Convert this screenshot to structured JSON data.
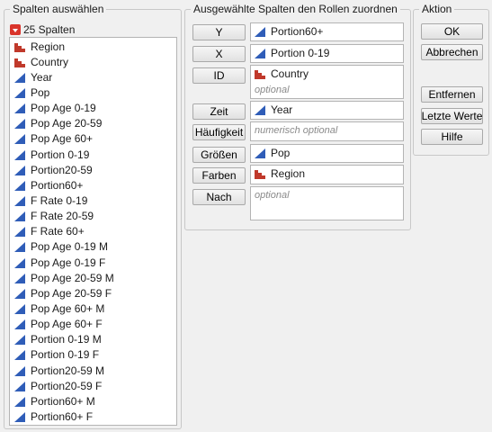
{
  "select_columns": {
    "legend": "Spalten auswählen",
    "count_label": "25 Spalten",
    "columns": [
      {
        "name": "Region",
        "type": "nominal"
      },
      {
        "name": "Country",
        "type": "nominal"
      },
      {
        "name": "Year",
        "type": "continuous"
      },
      {
        "name": "Pop",
        "type": "continuous"
      },
      {
        "name": "Pop Age 0-19",
        "type": "continuous"
      },
      {
        "name": "Pop Age 20-59",
        "type": "continuous"
      },
      {
        "name": "Pop Age 60+",
        "type": "continuous"
      },
      {
        "name": "Portion 0-19",
        "type": "continuous"
      },
      {
        "name": "Portion20-59",
        "type": "continuous"
      },
      {
        "name": "Portion60+",
        "type": "continuous"
      },
      {
        "name": "F Rate 0-19",
        "type": "continuous"
      },
      {
        "name": "F Rate 20-59",
        "type": "continuous"
      },
      {
        "name": "F Rate 60+",
        "type": "continuous"
      },
      {
        "name": "Pop Age 0-19 M",
        "type": "continuous"
      },
      {
        "name": "Pop Age 0-19 F",
        "type": "continuous"
      },
      {
        "name": "Pop Age 20-59 M",
        "type": "continuous"
      },
      {
        "name": "Pop Age 20-59 F",
        "type": "continuous"
      },
      {
        "name": "Pop Age 60+ M",
        "type": "continuous"
      },
      {
        "name": "Pop Age 60+ F",
        "type": "continuous"
      },
      {
        "name": "Portion 0-19 M",
        "type": "continuous"
      },
      {
        "name": "Portion 0-19 F",
        "type": "continuous"
      },
      {
        "name": "Portion20-59 M",
        "type": "continuous"
      },
      {
        "name": "Portion20-59 F",
        "type": "continuous"
      },
      {
        "name": "Portion60+ M",
        "type": "continuous"
      },
      {
        "name": "Portion60+ F",
        "type": "continuous"
      }
    ]
  },
  "roles": {
    "legend": "Ausgewählte Spalten den Rollen zuordnen",
    "items": [
      {
        "label": "Y",
        "entries": [
          {
            "name": "Portion60+",
            "type": "continuous"
          }
        ],
        "placeholder": ""
      },
      {
        "label": "X",
        "entries": [
          {
            "name": "Portion 0-19",
            "type": "continuous"
          }
        ],
        "placeholder": ""
      },
      {
        "label": "ID",
        "entries": [
          {
            "name": "Country",
            "type": "nominal"
          }
        ],
        "placeholder": "optional"
      },
      {
        "label": "Zeit",
        "entries": [
          {
            "name": "Year",
            "type": "continuous"
          }
        ],
        "placeholder": ""
      },
      {
        "label": "Häufigkeit",
        "entries": [],
        "placeholder": "numerisch optional"
      },
      {
        "label": "Größen",
        "entries": [
          {
            "name": "Pop",
            "type": "continuous"
          }
        ],
        "placeholder": ""
      },
      {
        "label": "Farben",
        "entries": [
          {
            "name": "Region",
            "type": "nominal"
          }
        ],
        "placeholder": ""
      },
      {
        "label": "Nach",
        "entries": [],
        "placeholder": "optional"
      }
    ]
  },
  "actions": {
    "legend": "Aktion",
    "ok": "OK",
    "cancel": "Abbrechen",
    "remove": "Entfernen",
    "recall": "Letzte Werte",
    "help": "Hilfe"
  },
  "colors": {
    "nominal_icon": "#c0392b",
    "continuous_icon": "#2f5db8"
  }
}
